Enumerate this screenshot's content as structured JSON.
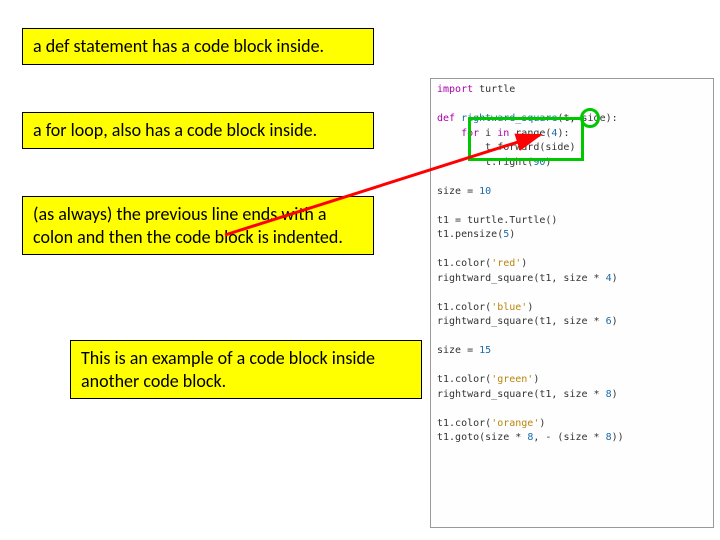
{
  "notes": {
    "n1": "a def statement has a code block inside.",
    "n2": "a for loop, also has a code block inside.",
    "n3": "(as always) the previous line ends with a colon and then the code block is indented.",
    "n4": "This is an example of a code block inside another code block."
  },
  "code": {
    "l1a": "import",
    "l1b": " turtle",
    "l2a": "def",
    "l2b": " rightward_square",
    "l2c": "(t, side):",
    "l3a": "    for",
    "l3b": " i ",
    "l3c": "in",
    "l3d": " range(",
    "l3e": "4",
    "l3f": "):",
    "l4": "        t.forward(side)",
    "l5a": "        t.right(",
    "l5b": "90",
    "l5c": ")",
    "l6a": "size = ",
    "l6b": "10",
    "l7": "t1 = turtle.Turtle()",
    "l8a": "t1.pensize(",
    "l8b": "5",
    "l8c": ")",
    "l9a": "t1.color(",
    "l9b": "'red'",
    "l9c": ")",
    "l10a": "rightward_square(t1, size * ",
    "l10b": "4",
    "l10c": ")",
    "l11a": "t1.color(",
    "l11b": "'blue'",
    "l11c": ")",
    "l12a": "rightward_square(t1, size * ",
    "l12b": "6",
    "l12c": ")",
    "l13a": "size = ",
    "l13b": "15",
    "l14a": "t1.color(",
    "l14b": "'green'",
    "l14c": ")",
    "l15a": "rightward_square(t1, size * ",
    "l15b": "8",
    "l15c": ")",
    "l16a": "t1.color(",
    "l16b": "'orange'",
    "l16c": ")",
    "l17a": "t1.goto(size * ",
    "l17b": "8",
    "l17c": ", - (size * ",
    "l17d": "8",
    "l17e": "))"
  }
}
